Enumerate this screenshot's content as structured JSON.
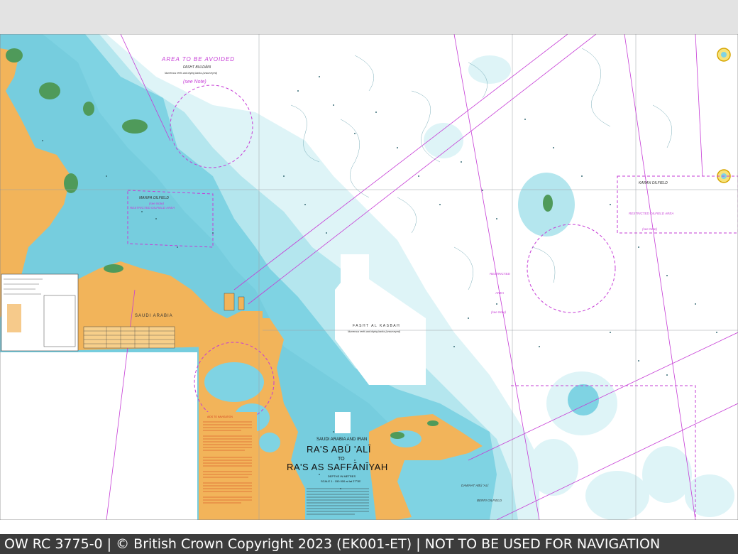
{
  "footer": {
    "text": "OW RC 3775-0 | © British Crown Copyright 2023 (EK001-ET) | NOT TO BE USED FOR NAVIGATION"
  },
  "chart": {
    "title_region": "SAUDI ARABIA AND IRAN",
    "title_line1": "RA'S ABŪ 'ALĪ",
    "title_to": "TO",
    "title_line2": "RA'S AS SAFFĀNĪYAH",
    "depths": "DEPTHS IN METRES",
    "scale": "SCALE 1 : 150 000 at lat 27°35'"
  },
  "labels": {
    "avoid_title": "AREA TO BE AVOIDED",
    "avoid_name": "FASHT BULDĀNI",
    "avoid_sub": "Numerous reefs and drying banks (unsurveyed)",
    "avoid_note": "(see Note)",
    "manifa": "MANIFA OILFIELD",
    "manifa_note": "(see Note)",
    "restricted_left": "RESTRICTED OILFIELD AREA",
    "saudi": "SAUDI ARABIA",
    "fasht_kasbah": "FASHT AL KASBAH",
    "kasbah_sub": "Numerous reefs and drying banks (unsurveyed)",
    "karan": "KARAN OILFIELD",
    "karan_note": "(see Note)",
    "restricted_right": "RESTRICTED OILFIELD AREA",
    "restricted_mid": "RESTRICTED",
    "area": "AREA",
    "area_note": "(see Note)",
    "berri": "BERRI OILFIELD",
    "dawhat": "DAWHAT ABŪ 'ALĪ",
    "note_heading": "AIDS TO NAVIGATION"
  },
  "colors": {
    "land": "#f2b45a",
    "mangrove": "#4f9a5a",
    "shallow": "#7fd3e3",
    "medium": "#b4e6ee",
    "light": "#def4f7",
    "deep": "#ffffff",
    "magenta": "#c63cd6",
    "note_red": "#d23a1c"
  }
}
